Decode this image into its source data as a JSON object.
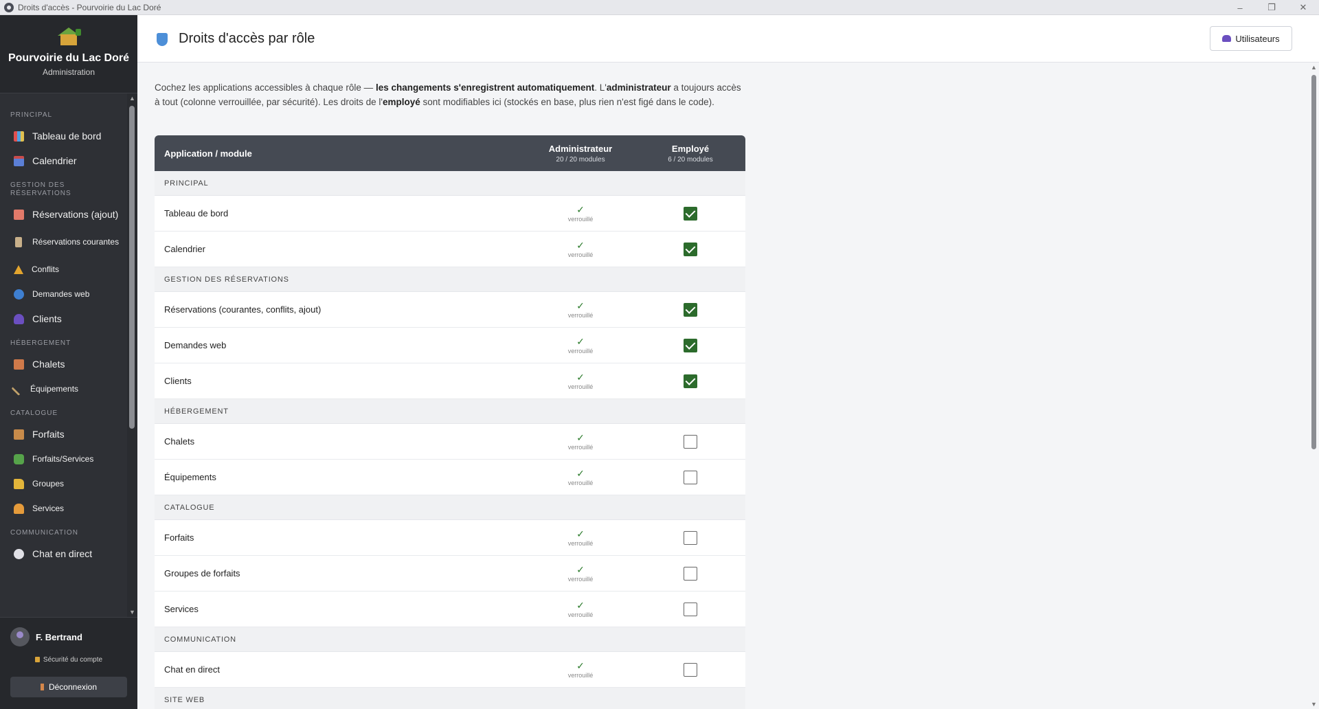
{
  "window": {
    "title": "Droits d'accès - Pourvoirie du Lac Doré",
    "controls": {
      "minimize": "–",
      "maximize": "❐",
      "close": "✕"
    }
  },
  "brand": {
    "name": "Pourvoirie du Lac Doré",
    "subtitle": "Administration"
  },
  "sidebar": {
    "sections": {
      "principal": "PRINCIPAL",
      "reservations": "GESTION DES RÉSERVATIONS",
      "hebergement": "HÉBERGEMENT",
      "catalogue": "CATALOGUE",
      "communication": "COMMUNICATION"
    },
    "items": {
      "tableau": "Tableau de bord",
      "calendrier": "Calendrier",
      "resa_ajout": "Réservations (ajout)",
      "resa_courantes": "Réservations courantes",
      "conflits": "Conflits",
      "demandes": "Demandes web",
      "clients": "Clients",
      "chalets": "Chalets",
      "equipements": "Équipements",
      "forfaits": "Forfaits",
      "forfaits_services": "Forfaits/Services",
      "groupes": "Groupes",
      "services": "Services",
      "chat": "Chat en direct"
    }
  },
  "user": {
    "name": "F. Bertrand",
    "security": "Sécurité du compte",
    "logout": "Déconnexion"
  },
  "header": {
    "title": "Droits d'accès par rôle",
    "users_button": "Utilisateurs"
  },
  "intro": {
    "p1": "Cochez les applications accessibles à chaque rôle — ",
    "b1": "les changements s'enregistrent automatiquement",
    "p2": ". L'",
    "b2": "administrateur",
    "p3": " a toujours accès à tout (colonne verrouillée, par sécurité). Les droits de l'",
    "b3": "employé",
    "p4": " sont modifiables ici (stockés en base, plus rien n'est figé dans le code)."
  },
  "table": {
    "col_app": "Application / module",
    "col_admin": "Administrateur",
    "col_admin_count": "20 / 20 modules",
    "col_employee": "Employé",
    "col_employee_count": "6 / 20 modules",
    "locked_mark": "✓",
    "locked_label": "verrouillé",
    "sections": {
      "principal": "PRINCIPAL",
      "reservations": "GESTION DES RÉSERVATIONS",
      "hebergement": "HÉBERGEMENT",
      "catalogue": "CATALOGUE",
      "communication": "COMMUNICATION",
      "siteweb": "SITE WEB"
    },
    "rows": {
      "tableau": {
        "label": "Tableau de bord",
        "employee": true
      },
      "calendrier": {
        "label": "Calendrier",
        "employee": true
      },
      "reservations": {
        "label": "Réservations (courantes, conflits, ajout)",
        "employee": true
      },
      "demandes": {
        "label": "Demandes web",
        "employee": true
      },
      "clients": {
        "label": "Clients",
        "employee": true
      },
      "chalets": {
        "label": "Chalets",
        "employee": false
      },
      "equipements": {
        "label": "Équipements",
        "employee": false
      },
      "forfaits": {
        "label": "Forfaits",
        "employee": false
      },
      "groupes": {
        "label": "Groupes de forfaits",
        "employee": false
      },
      "services": {
        "label": "Services",
        "employee": false
      },
      "chat": {
        "label": "Chat en direct",
        "employee": false
      }
    }
  }
}
